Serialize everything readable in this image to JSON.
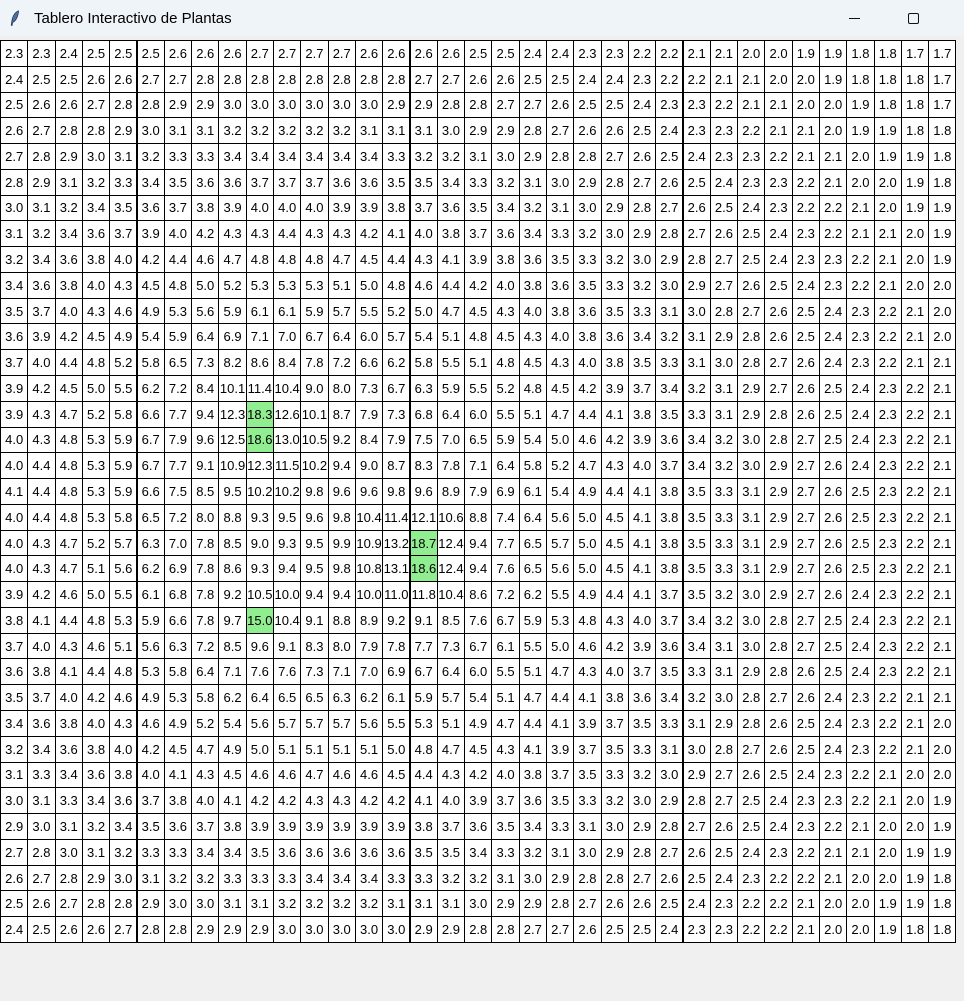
{
  "window": {
    "title": "Tablero Interactivo de Plantas",
    "app_icon": "feather-icon",
    "minimize_icon": "minimize-icon",
    "maximize_icon": "maximize-icon"
  },
  "colors": {
    "cell_bg": "#ffffff",
    "highlight_bg": "#90ee90",
    "border": "#000000"
  },
  "grid": {
    "rows": [
      [
        "2.3",
        "2.3",
        "2.4",
        "2.5",
        "2.5",
        "2.5",
        "2.6",
        "2.6",
        "2.6",
        "2.7",
        "2.7",
        "2.7",
        "2.7",
        "2.6",
        "2.6",
        "2.6",
        "2.6",
        "2.5",
        "2.5",
        "2.4",
        "2.4",
        "2.3",
        "2.3",
        "2.2",
        "2.2",
        "2.1",
        "2.1",
        "2.0",
        "2.0",
        "1.9",
        "1.9",
        "1.8",
        "1.8",
        "1.7",
        "1.7"
      ],
      [
        "2.4",
        "2.5",
        "2.5",
        "2.6",
        "2.6",
        "2.7",
        "2.7",
        "2.8",
        "2.8",
        "2.8",
        "2.8",
        "2.8",
        "2.8",
        "2.8",
        "2.8",
        "2.7",
        "2.7",
        "2.6",
        "2.6",
        "2.5",
        "2.5",
        "2.4",
        "2.4",
        "2.3",
        "2.2",
        "2.2",
        "2.1",
        "2.1",
        "2.0",
        "2.0",
        "1.9",
        "1.8",
        "1.8",
        "1.8",
        "1.7"
      ],
      [
        "2.5",
        "2.6",
        "2.6",
        "2.7",
        "2.8",
        "2.8",
        "2.9",
        "2.9",
        "3.0",
        "3.0",
        "3.0",
        "3.0",
        "3.0",
        "3.0",
        "2.9",
        "2.9",
        "2.8",
        "2.8",
        "2.7",
        "2.7",
        "2.6",
        "2.5",
        "2.5",
        "2.4",
        "2.3",
        "2.3",
        "2.2",
        "2.1",
        "2.1",
        "2.0",
        "2.0",
        "1.9",
        "1.8",
        "1.8",
        "1.7"
      ],
      [
        "2.6",
        "2.7",
        "2.8",
        "2.8",
        "2.9",
        "3.0",
        "3.1",
        "3.1",
        "3.2",
        "3.2",
        "3.2",
        "3.2",
        "3.2",
        "3.1",
        "3.1",
        "3.1",
        "3.0",
        "2.9",
        "2.9",
        "2.8",
        "2.7",
        "2.6",
        "2.6",
        "2.5",
        "2.4",
        "2.3",
        "2.3",
        "2.2",
        "2.1",
        "2.1",
        "2.0",
        "1.9",
        "1.9",
        "1.8",
        "1.8"
      ],
      [
        "2.7",
        "2.8",
        "2.9",
        "3.0",
        "3.1",
        "3.2",
        "3.3",
        "3.3",
        "3.4",
        "3.4",
        "3.4",
        "3.4",
        "3.4",
        "3.4",
        "3.3",
        "3.2",
        "3.2",
        "3.1",
        "3.0",
        "2.9",
        "2.8",
        "2.8",
        "2.7",
        "2.6",
        "2.5",
        "2.4",
        "2.3",
        "2.3",
        "2.2",
        "2.1",
        "2.1",
        "2.0",
        "1.9",
        "1.9",
        "1.8"
      ],
      [
        "2.8",
        "2.9",
        "3.1",
        "3.2",
        "3.3",
        "3.4",
        "3.5",
        "3.6",
        "3.6",
        "3.7",
        "3.7",
        "3.7",
        "3.6",
        "3.6",
        "3.5",
        "3.5",
        "3.4",
        "3.3",
        "3.2",
        "3.1",
        "3.0",
        "2.9",
        "2.8",
        "2.7",
        "2.6",
        "2.5",
        "2.4",
        "2.3",
        "2.3",
        "2.2",
        "2.1",
        "2.0",
        "2.0",
        "1.9",
        "1.8"
      ],
      [
        "3.0",
        "3.1",
        "3.2",
        "3.4",
        "3.5",
        "3.6",
        "3.7",
        "3.8",
        "3.9",
        "4.0",
        "4.0",
        "4.0",
        "3.9",
        "3.9",
        "3.8",
        "3.7",
        "3.6",
        "3.5",
        "3.4",
        "3.2",
        "3.1",
        "3.0",
        "2.9",
        "2.8",
        "2.7",
        "2.6",
        "2.5",
        "2.4",
        "2.3",
        "2.2",
        "2.2",
        "2.1",
        "2.0",
        "1.9",
        "1.9"
      ],
      [
        "3.1",
        "3.2",
        "3.4",
        "3.6",
        "3.7",
        "3.9",
        "4.0",
        "4.2",
        "4.3",
        "4.3",
        "4.4",
        "4.3",
        "4.3",
        "4.2",
        "4.1",
        "4.0",
        "3.8",
        "3.7",
        "3.6",
        "3.4",
        "3.3",
        "3.2",
        "3.0",
        "2.9",
        "2.8",
        "2.7",
        "2.6",
        "2.5",
        "2.4",
        "2.3",
        "2.2",
        "2.1",
        "2.1",
        "2.0",
        "1.9"
      ],
      [
        "3.2",
        "3.4",
        "3.6",
        "3.8",
        "4.0",
        "4.2",
        "4.4",
        "4.6",
        "4.7",
        "4.8",
        "4.8",
        "4.8",
        "4.7",
        "4.5",
        "4.4",
        "4.3",
        "4.1",
        "3.9",
        "3.8",
        "3.6",
        "3.5",
        "3.3",
        "3.2",
        "3.0",
        "2.9",
        "2.8",
        "2.7",
        "2.5",
        "2.4",
        "2.3",
        "2.3",
        "2.2",
        "2.1",
        "2.0",
        "1.9"
      ],
      [
        "3.4",
        "3.6",
        "3.8",
        "4.0",
        "4.3",
        "4.5",
        "4.8",
        "5.0",
        "5.2",
        "5.3",
        "5.3",
        "5.3",
        "5.1",
        "5.0",
        "4.8",
        "4.6",
        "4.4",
        "4.2",
        "4.0",
        "3.8",
        "3.6",
        "3.5",
        "3.3",
        "3.2",
        "3.0",
        "2.9",
        "2.7",
        "2.6",
        "2.5",
        "2.4",
        "2.3",
        "2.2",
        "2.1",
        "2.0",
        "2.0"
      ],
      [
        "3.5",
        "3.7",
        "4.0",
        "4.3",
        "4.6",
        "4.9",
        "5.3",
        "5.6",
        "5.9",
        "6.1",
        "6.1",
        "5.9",
        "5.7",
        "5.5",
        "5.2",
        "5.0",
        "4.7",
        "4.5",
        "4.3",
        "4.0",
        "3.8",
        "3.6",
        "3.5",
        "3.3",
        "3.1",
        "3.0",
        "2.8",
        "2.7",
        "2.6",
        "2.5",
        "2.4",
        "2.3",
        "2.2",
        "2.1",
        "2.0"
      ],
      [
        "3.6",
        "3.9",
        "4.2",
        "4.5",
        "4.9",
        "5.4",
        "5.9",
        "6.4",
        "6.9",
        "7.1",
        "7.0",
        "6.7",
        "6.4",
        "6.0",
        "5.7",
        "5.4",
        "5.1",
        "4.8",
        "4.5",
        "4.3",
        "4.0",
        "3.8",
        "3.6",
        "3.4",
        "3.2",
        "3.1",
        "2.9",
        "2.8",
        "2.6",
        "2.5",
        "2.4",
        "2.3",
        "2.2",
        "2.1",
        "2.0"
      ],
      [
        "3.7",
        "4.0",
        "4.4",
        "4.8",
        "5.2",
        "5.8",
        "6.5",
        "7.3",
        "8.2",
        "8.6",
        "8.4",
        "7.8",
        "7.2",
        "6.6",
        "6.2",
        "5.8",
        "5.5",
        "5.1",
        "4.8",
        "4.5",
        "4.3",
        "4.0",
        "3.8",
        "3.5",
        "3.3",
        "3.1",
        "3.0",
        "2.8",
        "2.7",
        "2.6",
        "2.4",
        "2.3",
        "2.2",
        "2.1",
        "2.1"
      ],
      [
        "3.9",
        "4.2",
        "4.5",
        "5.0",
        "5.5",
        "6.2",
        "7.2",
        "8.4",
        "10.1",
        "11.4",
        "10.4",
        "9.0",
        "8.0",
        "7.3",
        "6.7",
        "6.3",
        "5.9",
        "5.5",
        "5.2",
        "4.8",
        "4.5",
        "4.2",
        "3.9",
        "3.7",
        "3.4",
        "3.2",
        "3.1",
        "2.9",
        "2.7",
        "2.6",
        "2.5",
        "2.4",
        "2.3",
        "2.2",
        "2.1"
      ],
      [
        "3.9",
        "4.3",
        "4.7",
        "5.2",
        "5.8",
        "6.6",
        "7.7",
        "9.4",
        "12.3",
        "18.3",
        "12.6",
        "10.1",
        "8.7",
        "7.9",
        "7.3",
        "6.8",
        "6.4",
        "6.0",
        "5.5",
        "5.1",
        "4.7",
        "4.4",
        "4.1",
        "3.8",
        "3.5",
        "3.3",
        "3.1",
        "2.9",
        "2.8",
        "2.6",
        "2.5",
        "2.4",
        "2.3",
        "2.2",
        "2.1"
      ],
      [
        "4.0",
        "4.3",
        "4.8",
        "5.3",
        "5.9",
        "6.7",
        "7.9",
        "9.6",
        "12.5",
        "18.6",
        "13.0",
        "10.5",
        "9.2",
        "8.4",
        "7.9",
        "7.5",
        "7.0",
        "6.5",
        "5.9",
        "5.4",
        "5.0",
        "4.6",
        "4.2",
        "3.9",
        "3.6",
        "3.4",
        "3.2",
        "3.0",
        "2.8",
        "2.7",
        "2.5",
        "2.4",
        "2.3",
        "2.2",
        "2.1"
      ],
      [
        "4.0",
        "4.4",
        "4.8",
        "5.3",
        "5.9",
        "6.7",
        "7.7",
        "9.1",
        "10.9",
        "12.3",
        "11.5",
        "10.2",
        "9.4",
        "9.0",
        "8.7",
        "8.3",
        "7.8",
        "7.1",
        "6.4",
        "5.8",
        "5.2",
        "4.7",
        "4.3",
        "4.0",
        "3.7",
        "3.4",
        "3.2",
        "3.0",
        "2.9",
        "2.7",
        "2.6",
        "2.4",
        "2.3",
        "2.2",
        "2.1"
      ],
      [
        "4.1",
        "4.4",
        "4.8",
        "5.3",
        "5.9",
        "6.6",
        "7.5",
        "8.5",
        "9.5",
        "10.2",
        "10.2",
        "9.8",
        "9.6",
        "9.6",
        "9.8",
        "9.6",
        "8.9",
        "7.9",
        "6.9",
        "6.1",
        "5.4",
        "4.9",
        "4.4",
        "4.1",
        "3.8",
        "3.5",
        "3.3",
        "3.1",
        "2.9",
        "2.7",
        "2.6",
        "2.5",
        "2.3",
        "2.2",
        "2.1"
      ],
      [
        "4.0",
        "4.4",
        "4.8",
        "5.3",
        "5.8",
        "6.5",
        "7.2",
        "8.0",
        "8.8",
        "9.3",
        "9.5",
        "9.6",
        "9.8",
        "10.4",
        "11.4",
        "12.1",
        "10.6",
        "8.8",
        "7.4",
        "6.4",
        "5.6",
        "5.0",
        "4.5",
        "4.1",
        "3.8",
        "3.5",
        "3.3",
        "3.1",
        "2.9",
        "2.7",
        "2.6",
        "2.5",
        "2.3",
        "2.2",
        "2.1"
      ],
      [
        "4.0",
        "4.3",
        "4.7",
        "5.2",
        "5.7",
        "6.3",
        "7.0",
        "7.8",
        "8.5",
        "9.0",
        "9.3",
        "9.5",
        "9.9",
        "10.9",
        "13.2",
        "18.7",
        "12.4",
        "9.4",
        "7.7",
        "6.5",
        "5.7",
        "5.0",
        "4.5",
        "4.1",
        "3.8",
        "3.5",
        "3.3",
        "3.1",
        "2.9",
        "2.7",
        "2.6",
        "2.5",
        "2.3",
        "2.2",
        "2.1"
      ],
      [
        "4.0",
        "4.3",
        "4.7",
        "5.1",
        "5.6",
        "6.2",
        "6.9",
        "7.8",
        "8.6",
        "9.3",
        "9.4",
        "9.5",
        "9.8",
        "10.8",
        "13.1",
        "18.6",
        "12.4",
        "9.4",
        "7.6",
        "6.5",
        "5.6",
        "5.0",
        "4.5",
        "4.1",
        "3.8",
        "3.5",
        "3.3",
        "3.1",
        "2.9",
        "2.7",
        "2.6",
        "2.5",
        "2.3",
        "2.2",
        "2.1"
      ],
      [
        "3.9",
        "4.2",
        "4.6",
        "5.0",
        "5.5",
        "6.1",
        "6.8",
        "7.8",
        "9.2",
        "10.5",
        "10.0",
        "9.4",
        "9.4",
        "10.0",
        "11.0",
        "11.8",
        "10.4",
        "8.6",
        "7.2",
        "6.2",
        "5.5",
        "4.9",
        "4.4",
        "4.1",
        "3.7",
        "3.5",
        "3.2",
        "3.0",
        "2.9",
        "2.7",
        "2.6",
        "2.4",
        "2.3",
        "2.2",
        "2.1"
      ],
      [
        "3.8",
        "4.1",
        "4.4",
        "4.8",
        "5.3",
        "5.9",
        "6.6",
        "7.8",
        "9.7",
        "15.0",
        "10.4",
        "9.1",
        "8.8",
        "8.9",
        "9.2",
        "9.1",
        "8.5",
        "7.6",
        "6.7",
        "5.9",
        "5.3",
        "4.8",
        "4.3",
        "4.0",
        "3.7",
        "3.4",
        "3.2",
        "3.0",
        "2.8",
        "2.7",
        "2.5",
        "2.4",
        "2.3",
        "2.2",
        "2.1"
      ],
      [
        "3.7",
        "4.0",
        "4.3",
        "4.6",
        "5.1",
        "5.6",
        "6.3",
        "7.2",
        "8.5",
        "9.6",
        "9.1",
        "8.3",
        "8.0",
        "7.9",
        "7.8",
        "7.7",
        "7.3",
        "6.7",
        "6.1",
        "5.5",
        "5.0",
        "4.6",
        "4.2",
        "3.9",
        "3.6",
        "3.4",
        "3.1",
        "3.0",
        "2.8",
        "2.7",
        "2.5",
        "2.4",
        "2.3",
        "2.2",
        "2.1"
      ],
      [
        "3.6",
        "3.8",
        "4.1",
        "4.4",
        "4.8",
        "5.3",
        "5.8",
        "6.4",
        "7.1",
        "7.6",
        "7.6",
        "7.3",
        "7.1",
        "7.0",
        "6.9",
        "6.7",
        "6.4",
        "6.0",
        "5.5",
        "5.1",
        "4.7",
        "4.3",
        "4.0",
        "3.7",
        "3.5",
        "3.3",
        "3.1",
        "2.9",
        "2.8",
        "2.6",
        "2.5",
        "2.4",
        "2.3",
        "2.2",
        "2.1"
      ],
      [
        "3.5",
        "3.7",
        "4.0",
        "4.2",
        "4.6",
        "4.9",
        "5.3",
        "5.8",
        "6.2",
        "6.4",
        "6.5",
        "6.5",
        "6.3",
        "6.2",
        "6.1",
        "5.9",
        "5.7",
        "5.4",
        "5.1",
        "4.7",
        "4.4",
        "4.1",
        "3.8",
        "3.6",
        "3.4",
        "3.2",
        "3.0",
        "2.8",
        "2.7",
        "2.6",
        "2.4",
        "2.3",
        "2.2",
        "2.1",
        "2.1"
      ],
      [
        "3.4",
        "3.6",
        "3.8",
        "4.0",
        "4.3",
        "4.6",
        "4.9",
        "5.2",
        "5.4",
        "5.6",
        "5.7",
        "5.7",
        "5.7",
        "5.6",
        "5.5",
        "5.3",
        "5.1",
        "4.9",
        "4.7",
        "4.4",
        "4.1",
        "3.9",
        "3.7",
        "3.5",
        "3.3",
        "3.1",
        "2.9",
        "2.8",
        "2.6",
        "2.5",
        "2.4",
        "2.3",
        "2.2",
        "2.1",
        "2.0"
      ],
      [
        "3.2",
        "3.4",
        "3.6",
        "3.8",
        "4.0",
        "4.2",
        "4.5",
        "4.7",
        "4.9",
        "5.0",
        "5.1",
        "5.1",
        "5.1",
        "5.1",
        "5.0",
        "4.8",
        "4.7",
        "4.5",
        "4.3",
        "4.1",
        "3.9",
        "3.7",
        "3.5",
        "3.3",
        "3.1",
        "3.0",
        "2.8",
        "2.7",
        "2.6",
        "2.5",
        "2.4",
        "2.3",
        "2.2",
        "2.1",
        "2.0"
      ],
      [
        "3.1",
        "3.3",
        "3.4",
        "3.6",
        "3.8",
        "4.0",
        "4.1",
        "4.3",
        "4.5",
        "4.6",
        "4.6",
        "4.7",
        "4.6",
        "4.6",
        "4.5",
        "4.4",
        "4.3",
        "4.2",
        "4.0",
        "3.8",
        "3.7",
        "3.5",
        "3.3",
        "3.2",
        "3.0",
        "2.9",
        "2.7",
        "2.6",
        "2.5",
        "2.4",
        "2.3",
        "2.2",
        "2.1",
        "2.0",
        "2.0"
      ],
      [
        "3.0",
        "3.1",
        "3.3",
        "3.4",
        "3.6",
        "3.7",
        "3.8",
        "4.0",
        "4.1",
        "4.2",
        "4.2",
        "4.3",
        "4.3",
        "4.2",
        "4.2",
        "4.1",
        "4.0",
        "3.9",
        "3.7",
        "3.6",
        "3.5",
        "3.3",
        "3.2",
        "3.0",
        "2.9",
        "2.8",
        "2.7",
        "2.5",
        "2.4",
        "2.3",
        "2.3",
        "2.2",
        "2.1",
        "2.0",
        "1.9"
      ],
      [
        "2.9",
        "3.0",
        "3.1",
        "3.2",
        "3.4",
        "3.5",
        "3.6",
        "3.7",
        "3.8",
        "3.9",
        "3.9",
        "3.9",
        "3.9",
        "3.9",
        "3.9",
        "3.8",
        "3.7",
        "3.6",
        "3.5",
        "3.4",
        "3.3",
        "3.1",
        "3.0",
        "2.9",
        "2.8",
        "2.7",
        "2.6",
        "2.5",
        "2.4",
        "2.3",
        "2.2",
        "2.1",
        "2.0",
        "2.0",
        "1.9"
      ],
      [
        "2.7",
        "2.8",
        "3.0",
        "3.1",
        "3.2",
        "3.3",
        "3.3",
        "3.4",
        "3.4",
        "3.5",
        "3.6",
        "3.6",
        "3.6",
        "3.6",
        "3.6",
        "3.5",
        "3.5",
        "3.4",
        "3.3",
        "3.2",
        "3.1",
        "3.0",
        "2.9",
        "2.8",
        "2.7",
        "2.6",
        "2.5",
        "2.4",
        "2.3",
        "2.2",
        "2.1",
        "2.1",
        "2.0",
        "1.9",
        "1.9"
      ],
      [
        "2.6",
        "2.7",
        "2.8",
        "2.9",
        "3.0",
        "3.1",
        "3.2",
        "3.2",
        "3.3",
        "3.3",
        "3.3",
        "3.4",
        "3.4",
        "3.4",
        "3.3",
        "3.3",
        "3.2",
        "3.2",
        "3.1",
        "3.0",
        "2.9",
        "2.8",
        "2.8",
        "2.7",
        "2.6",
        "2.5",
        "2.4",
        "2.3",
        "2.2",
        "2.2",
        "2.1",
        "2.0",
        "2.0",
        "1.9",
        "1.8"
      ],
      [
        "2.5",
        "2.6",
        "2.7",
        "2.8",
        "2.8",
        "2.9",
        "3.0",
        "3.0",
        "3.1",
        "3.1",
        "3.2",
        "3.2",
        "3.2",
        "3.2",
        "3.1",
        "3.1",
        "3.1",
        "3.0",
        "2.9",
        "2.9",
        "2.8",
        "2.7",
        "2.6",
        "2.6",
        "2.5",
        "2.4",
        "2.3",
        "2.2",
        "2.2",
        "2.1",
        "2.0",
        "2.0",
        "1.9",
        "1.9",
        "1.8"
      ],
      [
        "2.4",
        "2.5",
        "2.6",
        "2.6",
        "2.7",
        "2.8",
        "2.8",
        "2.9",
        "2.9",
        "2.9",
        "3.0",
        "3.0",
        "3.0",
        "3.0",
        "3.0",
        "2.9",
        "2.9",
        "2.8",
        "2.8",
        "2.7",
        "2.7",
        "2.6",
        "2.5",
        "2.5",
        "2.4",
        "2.3",
        "2.3",
        "2.2",
        "2.2",
        "2.1",
        "2.0",
        "2.0",
        "1.9",
        "1.8",
        "1.8"
      ]
    ],
    "highlighted": [
      [
        14,
        9
      ],
      [
        15,
        9
      ],
      [
        19,
        15
      ],
      [
        20,
        15
      ],
      [
        22,
        9
      ]
    ]
  }
}
